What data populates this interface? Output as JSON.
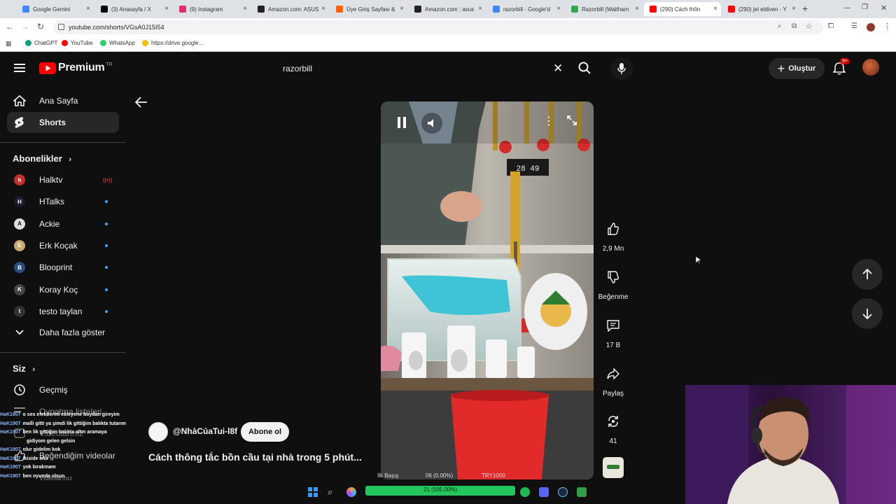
{
  "browser": {
    "tabs": [
      {
        "label": "Google Gemini",
        "color": "#4285f4"
      },
      {
        "label": "(3) Anasayfa / X",
        "color": "#000000"
      },
      {
        "label": "(9) Instagram",
        "color": "#e1306c"
      },
      {
        "label": "Amazon.com: ASUS",
        "color": "#222222"
      },
      {
        "label": "Üye Giriş Sayfası &",
        "color": "#ff6000"
      },
      {
        "label": "Amazon.com : asus",
        "color": "#222222"
      },
      {
        "label": "razorbill - Google'd",
        "color": "#4285f4"
      },
      {
        "label": "Razorbill (Waltham",
        "color": "#34a853"
      },
      {
        "label": "(290) Cách thôn",
        "color": "#ff0000"
      },
      {
        "label": "(290) jel eldiven - Y",
        "color": "#ff0000"
      }
    ],
    "new_tab": "+",
    "url": "youtube.com/shorts/VGsA0J15I54",
    "bookmarks": [
      {
        "label": "ChatGPT",
        "color": "#10a37f"
      },
      {
        "label": "YouTube",
        "color": "#ff0000"
      },
      {
        "label": "WhatsApp",
        "color": "#25d366"
      },
      {
        "label": "https://drive.google...",
        "color": "#fbbc04"
      }
    ]
  },
  "youtube": {
    "logo_text": "Premium",
    "logo_badge": "TR",
    "search_value": "razorbill",
    "create_label": "Oluştur",
    "notif_badge": "9+",
    "sidebar": {
      "main": [
        {
          "label": "Ana Sayfa"
        },
        {
          "label": "Shorts"
        }
      ],
      "subs_title": "Abonelikler",
      "channels": [
        {
          "label": "Halktv",
          "color": "#c4302b",
          "letter": "h"
        },
        {
          "label": "HTalks",
          "color": "#1a1a2e",
          "letter": "H"
        },
        {
          "label": "Ackie",
          "color": "#dddddd",
          "letter": "A"
        },
        {
          "label": "Erk Koçak",
          "color": "#c9a96e",
          "letter": "E"
        },
        {
          "label": "Blooprint",
          "color": "#2b4c7e",
          "letter": "B"
        },
        {
          "label": "Koray Koç",
          "color": "#444444",
          "letter": "K"
        },
        {
          "label": "testo taylan",
          "color": "#333333",
          "letter": "t"
        }
      ],
      "more_label": "Daha fazla göster",
      "you_title": "Siz",
      "you_items": [
        {
          "label": "Geçmiş"
        },
        {
          "label": "Oynatma listeleri"
        },
        {
          "label": "Videolarınız"
        },
        {
          "label": "Beğendiğim videolar"
        },
        {
          "label": "Videolarınız"
        }
      ]
    },
    "short": {
      "channel": "@NhàCủaTui-l8f",
      "subscribe": "Abone ol",
      "title": "Cách thông tắc bồn cầu tại nhà trong 5 phút...",
      "likes": "2,9 Mn",
      "dislike": "Beğenme",
      "comments": "17 B",
      "share": "Paylaş",
      "remix": "41",
      "clock": "28 49"
    }
  },
  "chat": [
    {
      "user": "HaK1907",
      "msg": "o ses efektlerini ekleyene boydan gireyim"
    },
    {
      "user": "HaK1907",
      "msg": "malli gitti ya şimdi lik gittiğim balıkta tutarım"
    },
    {
      "user": "HaK1907",
      "msg": "ben lik gittiğim balıkta altın aramaya"
    },
    {
      "user": "",
      "msg": "gidiyom gelen gelsin"
    },
    {
      "user": "HaK1907",
      "msg": "olur gidelim kok"
    },
    {
      "user": "HaK1907",
      "msg": "ikiside olur"
    },
    {
      "user": "HaK1907",
      "msg": "yok bırakmam"
    },
    {
      "user": "HaK1907",
      "msg": "ben oyunda olsun"
    }
  ],
  "taskbar": {
    "stat_left": "İlk Başış",
    "stat_mid": "06 (0.00%)",
    "stat_right": "TRY1000",
    "progress_label": "21 (105.00%)",
    "progress": 1.0
  }
}
